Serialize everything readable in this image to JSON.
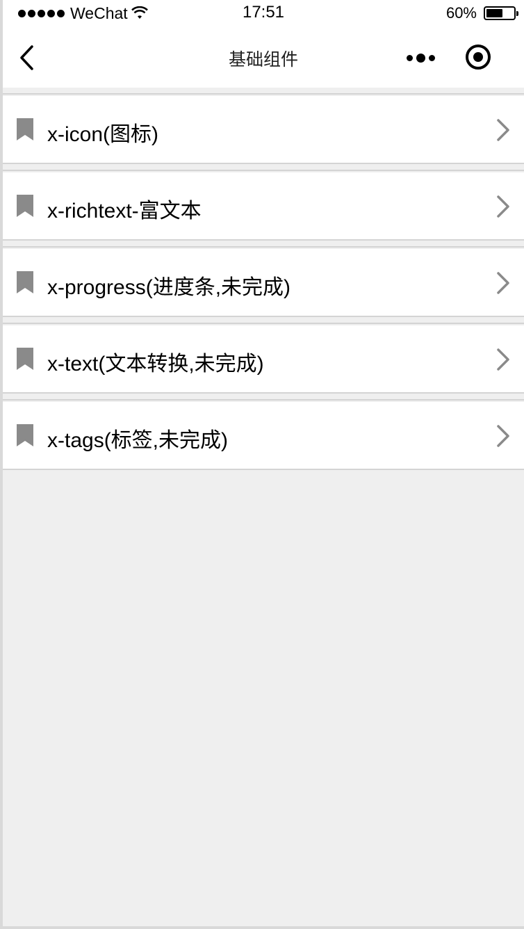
{
  "status_bar": {
    "carrier": "WeChat",
    "time": "17:51",
    "battery_percent": "60%",
    "battery_level": 0.6
  },
  "nav": {
    "title": "基础组件"
  },
  "list": {
    "items": [
      {
        "label": "x-icon(图标)"
      },
      {
        "label": "x-richtext-富文本"
      },
      {
        "label": "x-progress(进度条,未完成)"
      },
      {
        "label": "x-text(文本转换,未完成)"
      },
      {
        "label": "x-tags(标签,未完成)"
      }
    ]
  },
  "colors": {
    "page_background": "#efefef",
    "card_background": "#ffffff",
    "icon_gray": "#8a8a8a",
    "divider": "#d4d4d4"
  }
}
